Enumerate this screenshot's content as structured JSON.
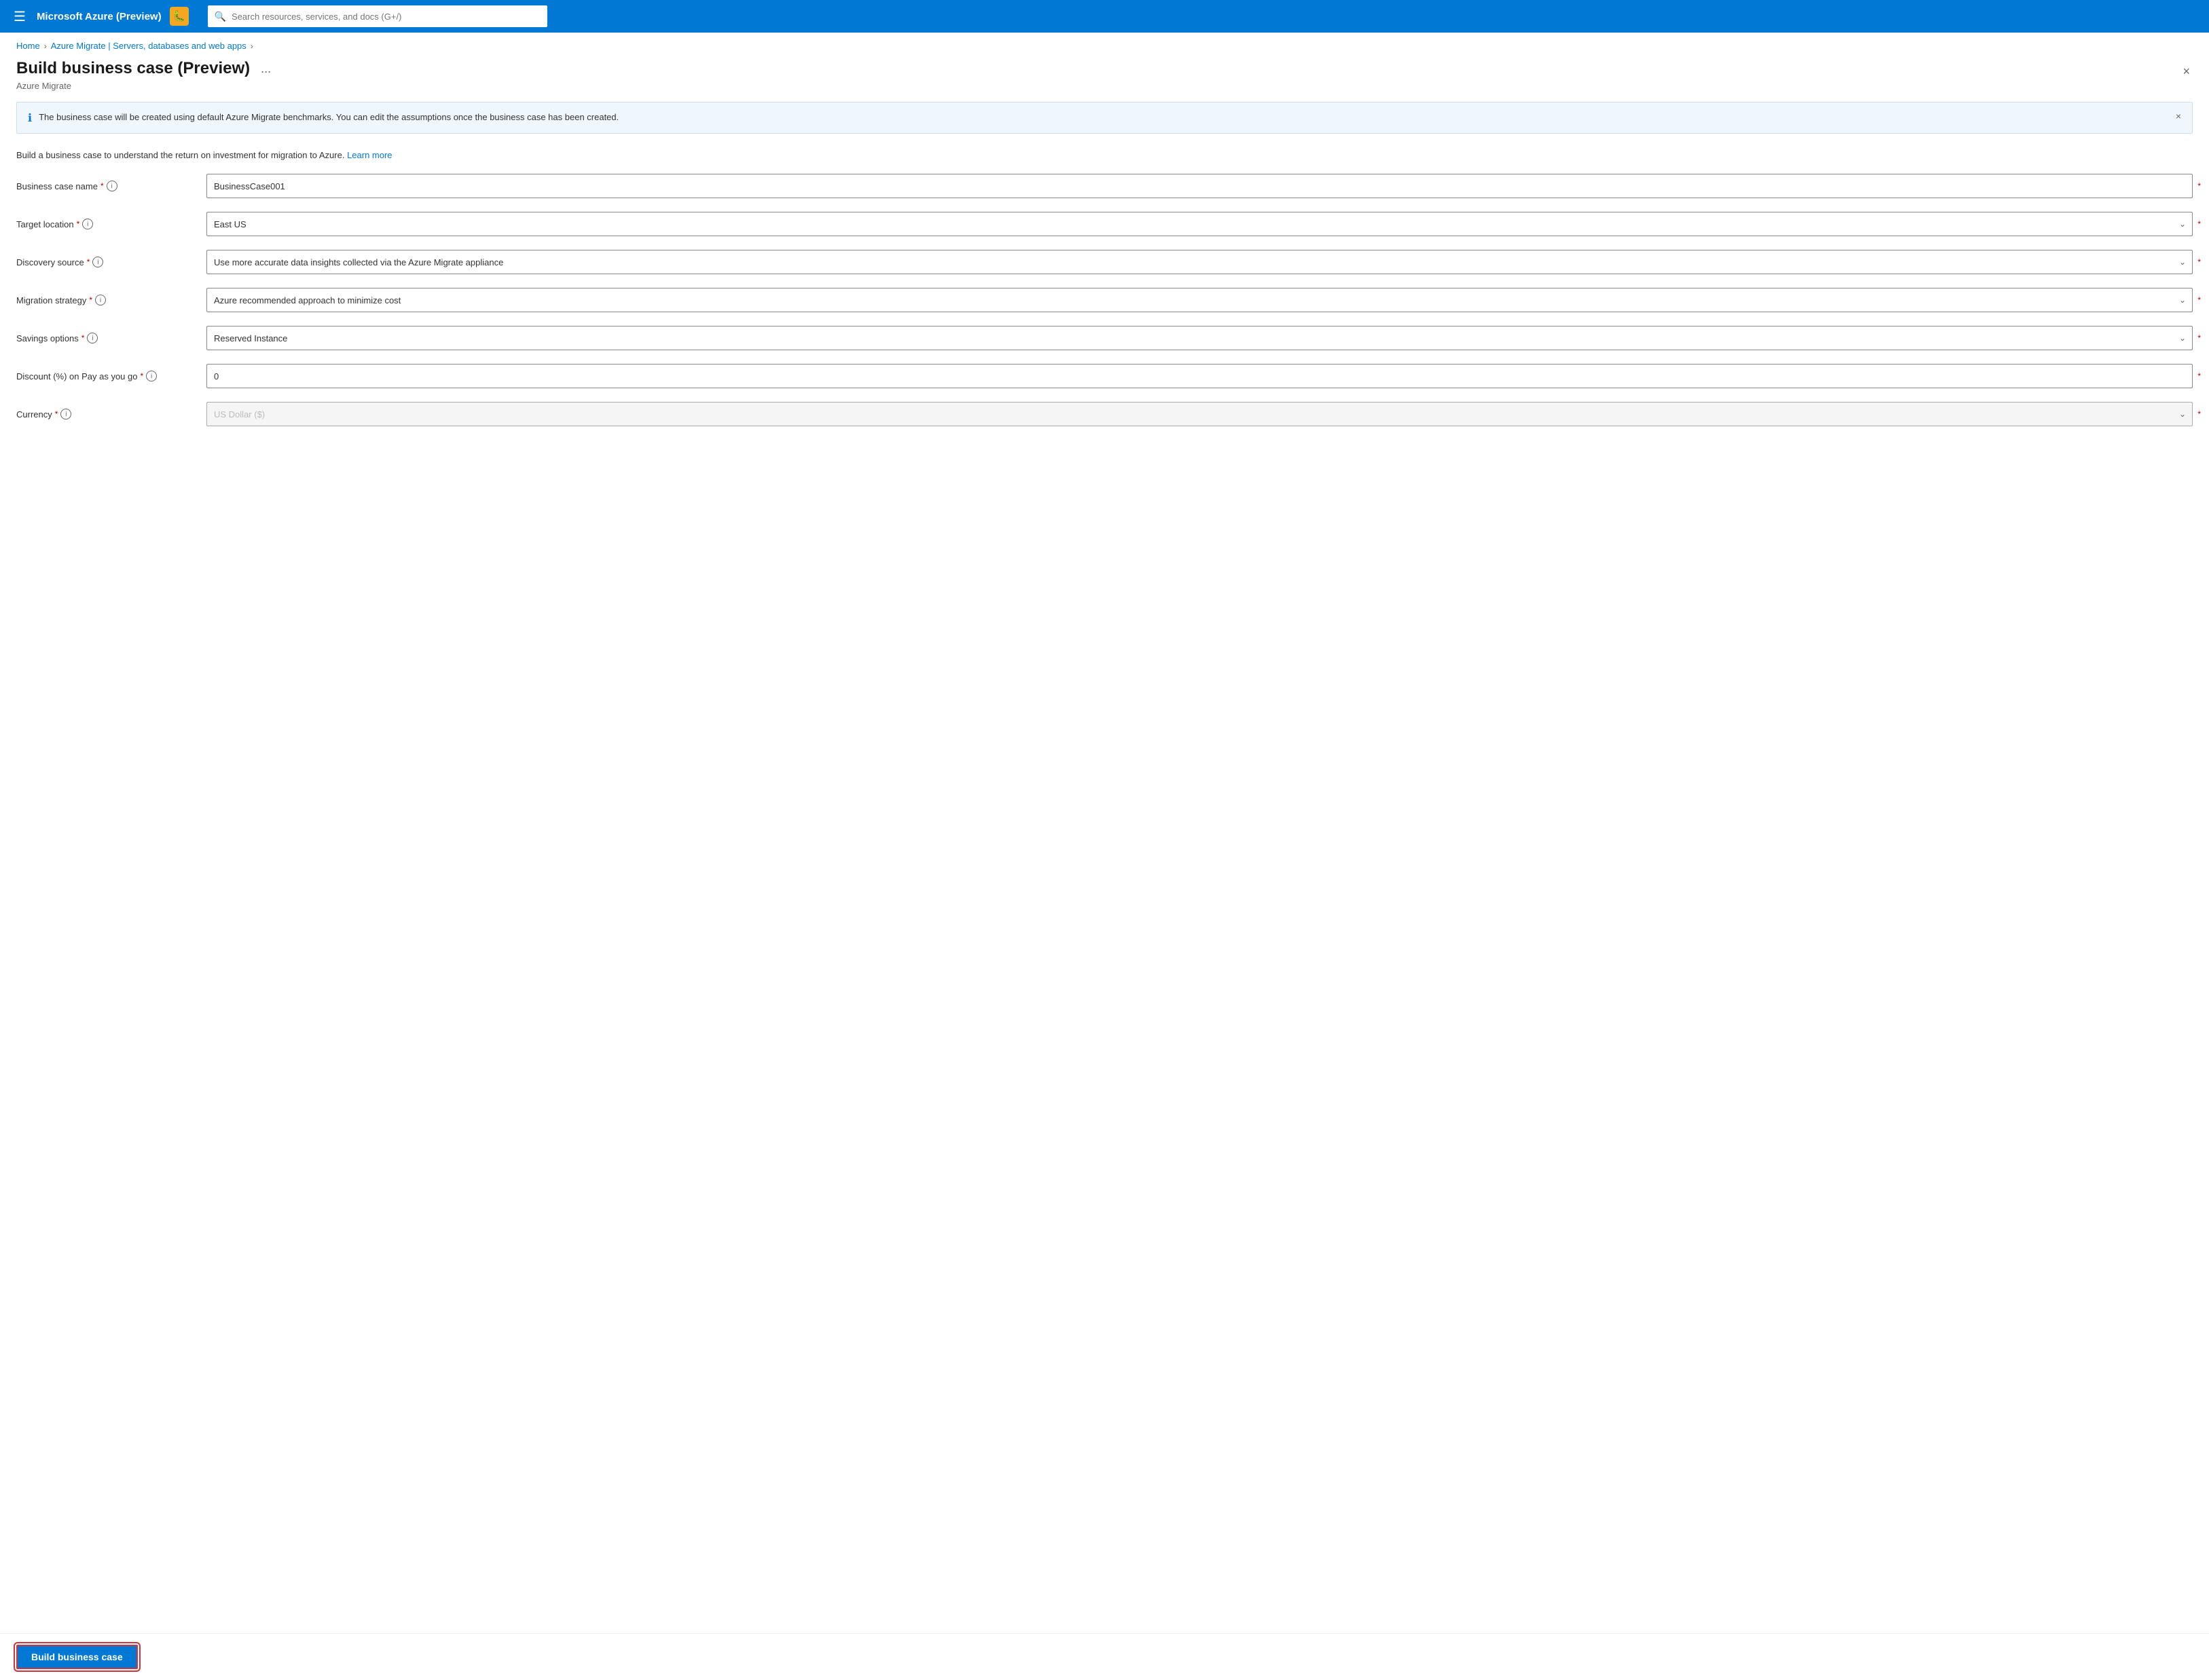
{
  "topbar": {
    "title": "Microsoft Azure (Preview)",
    "search_placeholder": "Search resources, services, and docs (G+/)",
    "bug_icon": "🐛"
  },
  "breadcrumb": {
    "home": "Home",
    "parent": "Azure Migrate | Servers, databases and web apps"
  },
  "panel": {
    "title": "Build business case (Preview)",
    "subtitle": "Azure Migrate",
    "ellipsis": "...",
    "close_icon": "×"
  },
  "info_banner": {
    "text": "The business case will be created using default Azure Migrate benchmarks. You can edit the assumptions once the business case has been created.",
    "close_icon": "×"
  },
  "description": {
    "text": "Build a business case to understand the return on investment for migration to Azure.",
    "learn_more": "Learn more"
  },
  "form": {
    "fields": [
      {
        "label": "Business case name",
        "type": "input",
        "value": "BusinessCase001",
        "required": true
      },
      {
        "label": "Target location",
        "type": "select",
        "value": "East US",
        "required": true,
        "disabled": false
      },
      {
        "label": "Discovery source",
        "type": "select",
        "value": "Use more accurate data insights collected via the Azure Migrate appliance",
        "required": true,
        "disabled": false
      },
      {
        "label": "Migration strategy",
        "type": "select",
        "value": "Azure recommended approach to minimize cost",
        "required": true,
        "disabled": false
      },
      {
        "label": "Savings options",
        "type": "select",
        "value": "Reserved Instance",
        "required": true,
        "disabled": false
      },
      {
        "label": "Discount (%) on Pay as you go",
        "type": "input",
        "value": "0",
        "required": true
      },
      {
        "label": "Currency",
        "type": "select",
        "value": "US Dollar ($)",
        "required": true,
        "disabled": true
      }
    ]
  },
  "actions": {
    "build_button_label": "Build business case"
  },
  "colors": {
    "azure_blue": "#0078d4",
    "required_red": "#a80000",
    "highlight_red": "#d13438"
  }
}
